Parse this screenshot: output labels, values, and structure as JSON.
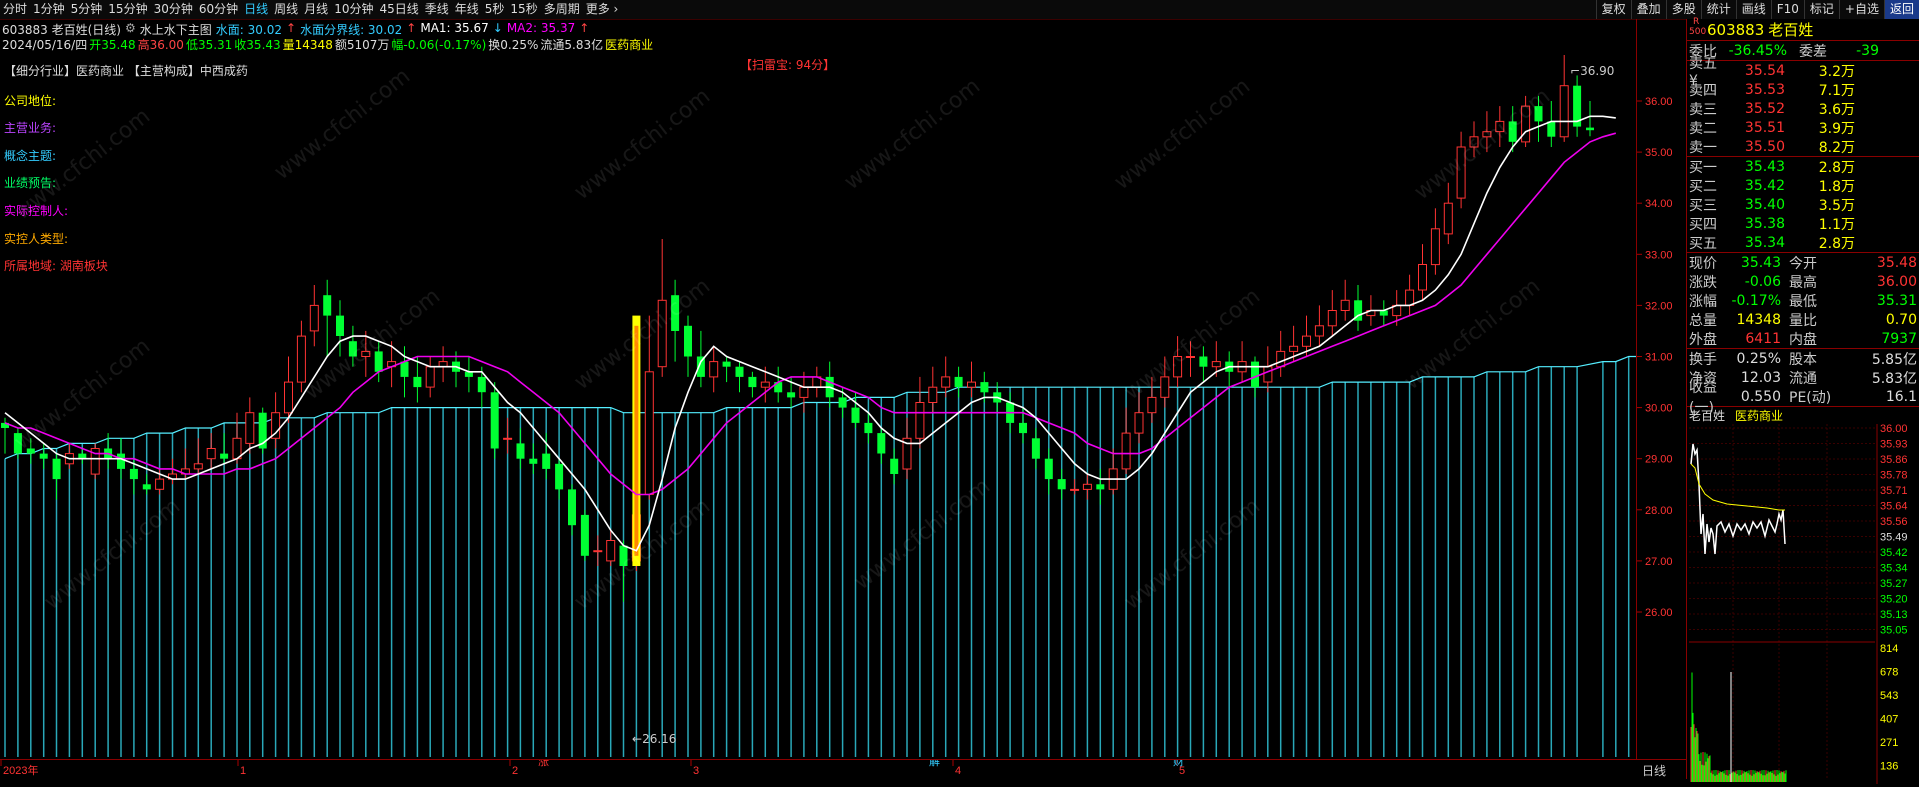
{
  "toolbar": {
    "periods": [
      "分时",
      "1分钟",
      "5分钟",
      "15分钟",
      "30分钟",
      "60分钟",
      "日线",
      "周线",
      "月线",
      "10分钟",
      "45日线",
      "季线",
      "年线",
      "5秒",
      "15秒",
      "多周期",
      "更多"
    ],
    "active_period": "日线",
    "right_buttons": [
      "复权",
      "叠加",
      "多股",
      "统计",
      "画线",
      "F10",
      "标记",
      "+自选",
      "返回"
    ]
  },
  "header": {
    "code_name": "603883 老百姓(日线)",
    "main_chart": "水上水下主图",
    "shuimian_label": "水面: 30.02",
    "shuimian_bound": "水面分界线: 30.02",
    "ma1": "MA1: 35.67",
    "ma2": "MA2: 35.37",
    "date": "2024/05/16/四",
    "open": "开35.48",
    "high": "高36.00",
    "low": "低35.31",
    "close": "收35.43",
    "volume": "量14348",
    "amount": "额5107万",
    "change": "幅-0.06(-0.17%)",
    "turnover": "换0.25%",
    "float_cap": "流通5.83亿",
    "sector": "医药商业"
  },
  "fundamentals": {
    "industry_line": "【细分行业】医药商业 【主营构成】中西成药",
    "scan_score": "【扫雷宝: 94分】",
    "company_position": "公司地位:",
    "main_business": "主营业务:",
    "concept": "概念主题:",
    "forecast": "业绩预告:",
    "controller": "实际控制人:",
    "controller_type": "实控人类型:",
    "region": "所属地域: 湖南板块"
  },
  "price_axis": {
    "ticks": [
      "36.00",
      "35.00",
      "34.00",
      "33.00",
      "32.00",
      "31.00",
      "30.00",
      "29.00",
      "28.00",
      "27.00",
      "26.00"
    ],
    "high_mark": "36.90",
    "low_mark": "26.16"
  },
  "time_axis": {
    "labels": [
      "2023年",
      "1",
      "2",
      "3",
      "4",
      "5"
    ],
    "markers": [
      "涨",
      "解",
      "财"
    ],
    "period_label": "日线"
  },
  "quote": {
    "code": "603883",
    "name": "老百姓",
    "corner_r": "R",
    "corner_num": "500",
    "weibi_label": "委比",
    "weibi": "-36.45%",
    "weicha_label": "委差",
    "weicha": "-39",
    "asks": [
      {
        "label": "卖五",
        "price": "35.54",
        "vol": "3.2万"
      },
      {
        "label": "卖四",
        "price": "35.53",
        "vol": "7.1万"
      },
      {
        "label": "卖三",
        "price": "35.52",
        "vol": "3.6万"
      },
      {
        "label": "卖二",
        "price": "35.51",
        "vol": "3.9万"
      },
      {
        "label": "卖一",
        "price": "35.50",
        "vol": "8.2万"
      }
    ],
    "bids": [
      {
        "label": "买一",
        "price": "35.43",
        "vol": "2.8万"
      },
      {
        "label": "买二",
        "price": "35.42",
        "vol": "1.8万"
      },
      {
        "label": "买三",
        "price": "35.40",
        "vol": "3.5万"
      },
      {
        "label": "买四",
        "price": "35.38",
        "vol": "1.1万"
      },
      {
        "label": "买五",
        "price": "35.34",
        "vol": "2.8万"
      }
    ],
    "stats": [
      {
        "l1": "现价",
        "v1": "35.43",
        "l2": "今开",
        "v2": "35.48"
      },
      {
        "l1": "涨跌",
        "v1": "-0.06",
        "l2": "最高",
        "v2": "36.00"
      },
      {
        "l1": "涨幅",
        "v1": "-0.17%",
        "l2": "最低",
        "v2": "35.31"
      },
      {
        "l1": "总量",
        "v1": "14348",
        "l2": "量比",
        "v2": "0.70"
      },
      {
        "l1": "外盘",
        "v1": "6411",
        "l2": "内盘",
        "v2": "7937"
      }
    ],
    "stats2": [
      {
        "l1": "换手",
        "v1": "0.25%",
        "l2": "股本",
        "v2": "5.85亿"
      },
      {
        "l1": "净资",
        "v1": "12.03",
        "l2": "流通",
        "v2": "5.83亿"
      },
      {
        "l1": "收益(一)",
        "v1": "0.550",
        "l2": "PE(动)",
        "v2": "16.1"
      }
    ],
    "mini_title": "老百姓",
    "mini_sector": "医药商业",
    "mini_ticks": [
      "36.00",
      "35.93",
      "35.86",
      "35.78",
      "35.71",
      "35.64",
      "35.56",
      "35.49",
      "35.42",
      "35.34",
      "35.27",
      "35.20",
      "35.13",
      "35.05"
    ],
    "mini_vol_ticks": [
      "814",
      "678",
      "543",
      "407",
      "271",
      "136"
    ]
  },
  "chart_data": {
    "type": "candlestick",
    "ylim": [
      25.8,
      37.4
    ],
    "candles": [
      [
        29.7,
        29.6,
        29.8,
        29.1
      ],
      [
        29.5,
        29.1,
        29.6,
        29.0
      ],
      [
        29.2,
        29.1,
        29.4,
        28.9
      ],
      [
        29.1,
        29.0,
        29.3,
        28.8
      ],
      [
        29.0,
        28.6,
        29.1,
        28.2
      ],
      [
        28.9,
        29.1,
        29.3,
        28.8
      ],
      [
        29.1,
        29.0,
        29.2,
        28.9
      ],
      [
        28.7,
        29.2,
        29.3,
        28.6
      ],
      [
        29.2,
        29.0,
        29.5,
        28.8
      ],
      [
        29.1,
        28.8,
        29.4,
        28.6
      ],
      [
        28.8,
        28.6,
        29.0,
        28.3
      ],
      [
        28.5,
        28.4,
        28.7,
        28.3
      ],
      [
        28.4,
        28.6,
        28.8,
        28.3
      ],
      [
        28.6,
        28.7,
        29.0,
        28.5
      ],
      [
        28.7,
        28.8,
        29.2,
        28.6
      ],
      [
        28.8,
        28.9,
        29.4,
        28.7
      ],
      [
        29.0,
        29.2,
        29.5,
        28.8
      ],
      [
        29.1,
        29.0,
        29.5,
        28.9
      ],
      [
        29.0,
        29.4,
        29.9,
        28.9
      ],
      [
        29.3,
        29.9,
        30.2,
        29.1
      ],
      [
        29.9,
        29.2,
        30.0,
        29.1
      ],
      [
        29.4,
        29.9,
        30.3,
        29.2
      ],
      [
        29.9,
        30.5,
        31.0,
        29.7
      ],
      [
        30.5,
        31.4,
        31.7,
        30.3
      ],
      [
        31.5,
        32.0,
        32.4,
        31.2
      ],
      [
        32.2,
        31.8,
        32.5,
        31.0
      ],
      [
        31.8,
        31.4,
        32.1,
        31.0
      ],
      [
        31.3,
        31.0,
        31.6,
        30.8
      ],
      [
        31.0,
        31.1,
        31.5,
        30.6
      ],
      [
        31.1,
        30.7,
        31.3,
        30.5
      ],
      [
        30.8,
        30.9,
        31.3,
        30.4
      ],
      [
        30.9,
        30.6,
        31.2,
        30.2
      ],
      [
        30.6,
        30.4,
        31.0,
        30.1
      ],
      [
        30.4,
        30.8,
        31.0,
        30.2
      ],
      [
        30.8,
        30.9,
        31.2,
        30.5
      ],
      [
        30.9,
        30.7,
        31.1,
        30.4
      ],
      [
        30.7,
        30.6,
        31.0,
        30.3
      ],
      [
        30.6,
        30.3,
        30.8,
        30.0
      ],
      [
        30.3,
        29.2,
        30.5,
        29.0
      ],
      [
        29.4,
        29.4,
        29.8,
        29.1
      ],
      [
        29.3,
        29.0,
        29.6,
        28.8
      ],
      [
        29.0,
        28.9,
        29.3,
        28.7
      ],
      [
        29.1,
        28.8,
        29.5,
        28.6
      ],
      [
        28.9,
        28.4,
        29.0,
        28.2
      ],
      [
        28.4,
        27.7,
        28.5,
        27.5
      ],
      [
        27.9,
        27.1,
        28.0,
        27.0
      ],
      [
        27.2,
        27.2,
        27.5,
        26.9
      ],
      [
        27.0,
        27.4,
        27.6,
        26.9
      ],
      [
        27.3,
        26.9,
        27.4,
        26.2
      ],
      [
        27.0,
        27.9,
        28.4,
        26.8
      ],
      [
        28.3,
        30.7,
        31.8,
        28.2
      ],
      [
        30.8,
        32.1,
        33.3,
        30.6
      ],
      [
        32.2,
        31.5,
        32.5,
        30.9
      ],
      [
        31.6,
        31.0,
        31.8,
        30.6
      ],
      [
        31.0,
        30.6,
        31.5,
        30.4
      ],
      [
        30.6,
        30.9,
        31.2,
        30.3
      ],
      [
        30.9,
        30.8,
        31.0,
        30.5
      ],
      [
        30.8,
        30.6,
        30.9,
        30.3
      ],
      [
        30.6,
        30.4,
        30.7,
        30.2
      ],
      [
        30.4,
        30.5,
        30.8,
        30.1
      ],
      [
        30.5,
        30.3,
        30.8,
        30.1
      ],
      [
        30.3,
        30.2,
        30.6,
        30.0
      ],
      [
        30.2,
        30.4,
        30.7,
        29.9
      ],
      [
        30.4,
        30.6,
        30.8,
        30.2
      ],
      [
        30.6,
        30.2,
        30.9,
        30.0
      ],
      [
        30.2,
        30.0,
        30.4,
        29.8
      ],
      [
        30.0,
        29.7,
        30.3,
        29.6
      ],
      [
        29.7,
        29.5,
        29.9,
        29.3
      ],
      [
        29.5,
        29.1,
        29.6,
        28.9
      ],
      [
        29.0,
        28.7,
        29.2,
        28.5
      ],
      [
        28.8,
        29.4,
        29.8,
        28.6
      ],
      [
        29.4,
        30.1,
        30.6,
        29.2
      ],
      [
        30.1,
        30.4,
        30.8,
        29.9
      ],
      [
        30.4,
        30.6,
        31.0,
        30.2
      ],
      [
        30.6,
        30.4,
        30.8,
        30.2
      ],
      [
        30.4,
        30.5,
        30.9,
        30.2
      ],
      [
        30.5,
        30.3,
        30.7,
        30.1
      ],
      [
        30.3,
        30.1,
        30.5,
        29.9
      ],
      [
        30.1,
        29.7,
        30.3,
        29.5
      ],
      [
        29.7,
        29.5,
        30.0,
        29.3
      ],
      [
        29.4,
        29.0,
        29.6,
        28.8
      ],
      [
        29.0,
        28.6,
        29.2,
        28.3
      ],
      [
        28.6,
        28.4,
        28.8,
        28.2
      ],
      [
        28.4,
        28.4,
        28.6,
        28.3
      ],
      [
        28.4,
        28.5,
        28.7,
        28.2
      ],
      [
        28.5,
        28.4,
        28.8,
        28.1
      ],
      [
        28.4,
        28.8,
        29.2,
        28.3
      ],
      [
        28.8,
        29.5,
        30.0,
        28.7
      ],
      [
        29.5,
        29.9,
        30.3,
        29.3
      ],
      [
        29.9,
        30.2,
        30.6,
        29.7
      ],
      [
        30.2,
        30.6,
        31.0,
        30.0
      ],
      [
        30.6,
        31.0,
        31.4,
        30.4
      ],
      [
        31.0,
        31.0,
        31.3,
        30.6
      ],
      [
        31.0,
        30.8,
        31.2,
        30.5
      ],
      [
        30.8,
        30.9,
        31.3,
        30.6
      ],
      [
        30.9,
        30.7,
        31.1,
        30.4
      ],
      [
        30.7,
        30.9,
        31.3,
        30.5
      ],
      [
        30.9,
        30.4,
        31.0,
        30.2
      ],
      [
        30.5,
        30.8,
        31.2,
        30.3
      ],
      [
        30.8,
        31.1,
        31.5,
        30.6
      ],
      [
        31.1,
        31.2,
        31.6,
        30.9
      ],
      [
        31.2,
        31.4,
        31.8,
        31.0
      ],
      [
        31.4,
        31.6,
        32.0,
        31.2
      ],
      [
        31.6,
        31.9,
        32.3,
        31.4
      ],
      [
        31.9,
        32.1,
        32.5,
        31.7
      ],
      [
        32.1,
        31.7,
        32.4,
        31.5
      ],
      [
        31.8,
        31.9,
        32.2,
        31.6
      ],
      [
        31.9,
        31.8,
        32.1,
        31.6
      ],
      [
        31.8,
        32.0,
        32.3,
        31.6
      ],
      [
        32.0,
        32.3,
        32.6,
        31.8
      ],
      [
        32.3,
        32.8,
        33.2,
        32.1
      ],
      [
        32.8,
        33.5,
        33.9,
        32.6
      ],
      [
        33.4,
        34.0,
        34.4,
        33.2
      ],
      [
        34.1,
        35.1,
        35.4,
        33.9
      ],
      [
        35.1,
        35.3,
        35.6,
        34.9
      ],
      [
        35.3,
        35.4,
        35.8,
        35.0
      ],
      [
        35.4,
        35.6,
        35.9,
        35.1
      ],
      [
        35.6,
        35.2,
        35.9,
        35.0
      ],
      [
        35.2,
        35.9,
        36.1,
        35.1
      ],
      [
        35.9,
        35.6,
        36.1,
        35.2
      ],
      [
        35.6,
        35.3,
        36.0,
        35.1
      ],
      [
        35.3,
        36.3,
        36.9,
        35.2
      ],
      [
        36.3,
        35.5,
        36.5,
        35.3
      ],
      [
        35.48,
        35.43,
        36.0,
        35.31
      ]
    ],
    "ma1": [
      29.9,
      29.7,
      29.5,
      29.3,
      29.1,
      29.0,
      29.0,
      29.0,
      29.0,
      29.0,
      28.9,
      28.8,
      28.7,
      28.6,
      28.6,
      28.7,
      28.8,
      28.9,
      29.0,
      29.2,
      29.3,
      29.5,
      29.8,
      30.2,
      30.6,
      31.0,
      31.3,
      31.4,
      31.4,
      31.3,
      31.2,
      31.0,
      30.9,
      30.8,
      30.8,
      30.8,
      30.7,
      30.7,
      30.4,
      30.1,
      29.9,
      29.6,
      29.3,
      29.0,
      28.7,
      28.4,
      28.0,
      27.6,
      27.3,
      27.2,
      27.7,
      28.6,
      29.6,
      30.3,
      30.9,
      31.2,
      31.0,
      30.9,
      30.8,
      30.7,
      30.6,
      30.5,
      30.4,
      30.4,
      30.4,
      30.3,
      30.1,
      29.9,
      29.6,
      29.4,
      29.3,
      29.3,
      29.5,
      29.7,
      29.9,
      30.1,
      30.2,
      30.2,
      30.1,
      30.0,
      29.8,
      29.5,
      29.2,
      28.9,
      28.7,
      28.6,
      28.6,
      28.6,
      28.8,
      29.1,
      29.5,
      29.9,
      30.3,
      30.5,
      30.7,
      30.8,
      30.8,
      30.8,
      30.8,
      30.9,
      31.0,
      31.1,
      31.2,
      31.4,
      31.6,
      31.8,
      31.9,
      31.9,
      32.0,
      32.0,
      32.1,
      32.3,
      32.6,
      33.0,
      33.6,
      34.2,
      34.7,
      35.1,
      35.4,
      35.5,
      35.6,
      35.6,
      35.6,
      35.7,
      35.7,
      35.67
    ],
    "ma2": [
      29.7,
      29.6,
      29.6,
      29.5,
      29.4,
      29.3,
      29.2,
      29.1,
      29.1,
      29.0,
      29.0,
      28.9,
      28.8,
      28.8,
      28.7,
      28.7,
      28.7,
      28.7,
      28.8,
      28.8,
      28.9,
      29.0,
      29.2,
      29.4,
      29.6,
      29.8,
      30.0,
      30.3,
      30.5,
      30.7,
      30.8,
      30.9,
      31.0,
      31.0,
      31.0,
      31.0,
      31.0,
      30.9,
      30.8,
      30.7,
      30.5,
      30.3,
      30.1,
      29.9,
      29.6,
      29.3,
      29.0,
      28.7,
      28.5,
      28.3,
      28.3,
      28.4,
      28.6,
      28.8,
      29.1,
      29.4,
      29.7,
      29.9,
      30.1,
      30.3,
      30.5,
      30.6,
      30.6,
      30.6,
      30.5,
      30.4,
      30.3,
      30.2,
      30.0,
      29.9,
      29.9,
      29.9,
      29.9,
      29.9,
      29.9,
      29.9,
      29.9,
      29.9,
      29.9,
      29.9,
      29.8,
      29.7,
      29.6,
      29.5,
      29.3,
      29.2,
      29.1,
      29.1,
      29.1,
      29.2,
      29.4,
      29.6,
      29.8,
      30.0,
      30.2,
      30.4,
      30.5,
      30.6,
      30.7,
      30.8,
      30.9,
      31.0,
      31.1,
      31.2,
      31.3,
      31.4,
      31.5,
      31.6,
      31.7,
      31.8,
      31.9,
      32.0,
      32.2,
      32.4,
      32.7,
      33.0,
      33.3,
      33.6,
      33.9,
      34.2,
      34.5,
      34.8,
      35.0,
      35.2,
      35.3,
      35.37
    ],
    "water": [
      29.0,
      29.1,
      29.1,
      29.2,
      29.2,
      29.3,
      29.3,
      29.3,
      29.4,
      29.4,
      29.4,
      29.5,
      29.5,
      29.5,
      29.6,
      29.6,
      29.6,
      29.7,
      29.7,
      29.7,
      29.7,
      29.8,
      29.8,
      29.8,
      29.8,
      29.9,
      29.9,
      29.9,
      29.9,
      29.9,
      30.0,
      30.0,
      30.0,
      30.0,
      30.0,
      30.0,
      30.0,
      30.0,
      30.0,
      30.0,
      30.0,
      30.0,
      30.0,
      30.0,
      30.0,
      30.0,
      30.0,
      30.0,
      29.9,
      29.9,
      29.9,
      29.9,
      29.9,
      29.9,
      29.9,
      29.9,
      30.0,
      30.0,
      30.0,
      30.0,
      30.0,
      30.0,
      30.1,
      30.1,
      30.1,
      30.1,
      30.2,
      30.2,
      30.2,
      30.2,
      30.3,
      30.3,
      30.3,
      30.3,
      30.4,
      30.4,
      30.4,
      30.4,
      30.4,
      30.4,
      30.4,
      30.4,
      30.4,
      30.4,
      30.4,
      30.4,
      30.4,
      30.4,
      30.4,
      30.4,
      30.4,
      30.4,
      30.4,
      30.4,
      30.4,
      30.4,
      30.4,
      30.4,
      30.4,
      30.4,
      30.4,
      30.4,
      30.4,
      30.5,
      30.5,
      30.5,
      30.5,
      30.5,
      30.5,
      30.5,
      30.6,
      30.6,
      30.6,
      30.6,
      30.6,
      30.7,
      30.7,
      30.7,
      30.7,
      30.8,
      30.8,
      30.8,
      30.8,
      30.9,
      30.9,
      30.9,
      31.0,
      31.0,
      30.02
    ]
  }
}
